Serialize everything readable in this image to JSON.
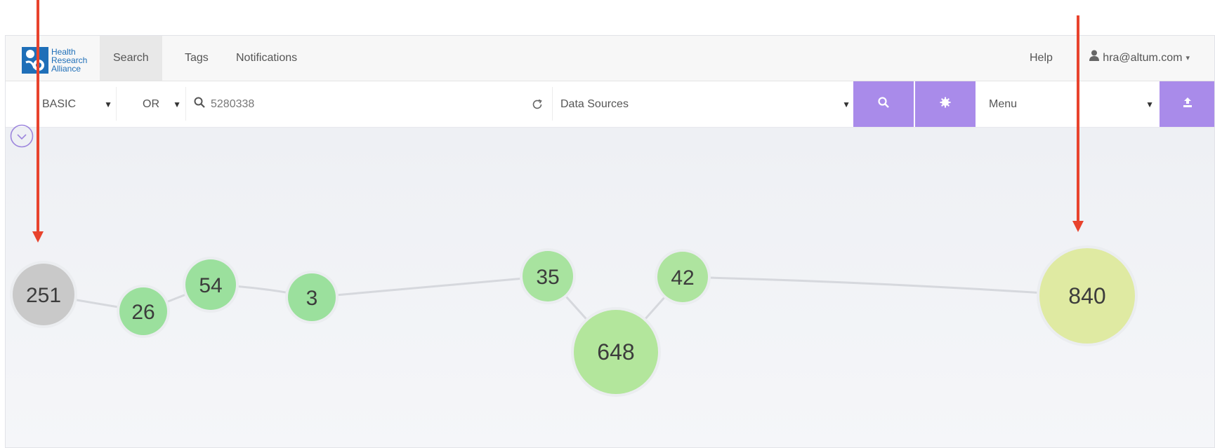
{
  "nav": {
    "logo_text": [
      "Health",
      "Research",
      "Alliance"
    ],
    "items": [
      {
        "label": "Search",
        "active": true
      },
      {
        "label": "Tags",
        "active": false
      },
      {
        "label": "Notifications",
        "active": false
      }
    ],
    "help_label": "Help",
    "user_email": "hra@altum.com"
  },
  "toolbar": {
    "mode_value": "BASIC",
    "operator_value": "OR",
    "search_value": "5280338",
    "data_sources_label": "Data Sources",
    "menu_label": "Menu"
  },
  "graph": {
    "nodes": [
      {
        "label": "251",
        "color": "#c9c9c9"
      },
      {
        "label": "26",
        "color": "#9be09d"
      },
      {
        "label": "54",
        "color": "#9be09d"
      },
      {
        "label": "3",
        "color": "#9be09d"
      },
      {
        "label": "35",
        "color": "#a8e39f"
      },
      {
        "label": "648",
        "color": "#b3e69c"
      },
      {
        "label": "42",
        "color": "#aee49f"
      },
      {
        "label": "840",
        "color": "#dfeaa2"
      }
    ]
  },
  "colors": {
    "accent": "#a98bea",
    "annotation_arrow": "#e8432d"
  }
}
